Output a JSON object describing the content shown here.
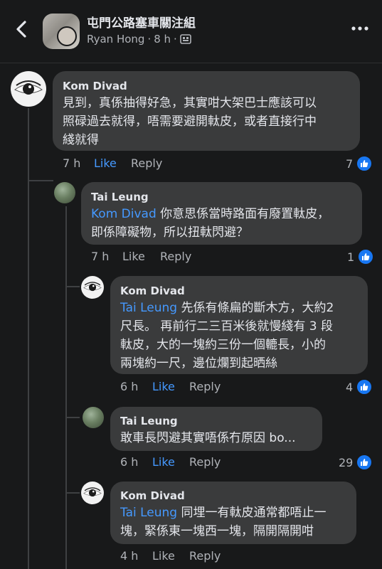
{
  "header": {
    "title": "屯門公路塞車關注組",
    "author": "Ryan Hong",
    "time": "8 h",
    "separator": "·"
  },
  "comments": [
    {
      "name": "Kom Divad",
      "mention": "",
      "text_lines": [
        "見到，真係抽得好急，其實咁大架巴士應該可以",
        "照碌過去就得，唔需要避開軚皮，或者直接行中",
        "綫就得"
      ],
      "time": "7 h",
      "like": "Like",
      "reply": "Reply",
      "reactions": "7",
      "like_active": true
    },
    {
      "name": "Tai Leung",
      "mention": "Kom Divad",
      "text_lines": [
        " 你意思係當時路面有廢置軚皮，",
        "即係障礙物，所以扭軚閃避？"
      ],
      "time": "7 h",
      "like": "Like",
      "reply": "Reply",
      "reactions": "1",
      "like_active": false
    },
    {
      "name": "Kom Divad",
      "mention": "Tai Leung",
      "text_lines": [
        " 先係有條扁的斷木方，大約2",
        "尺長。 再前行二三百米後就慢綫有 3 段",
        "軚皮，大的一塊約三份一個轆長，小的",
        "兩塊約一尺，邊位爛到起晒絲"
      ],
      "time": "6 h",
      "like": "Like",
      "reply": "Reply",
      "reactions": "4",
      "like_active": true
    },
    {
      "name": "Tai Leung",
      "mention": "",
      "text_lines": [
        "敢車長閃避其實唔係冇原因 bo..."
      ],
      "time": "6 h",
      "like": "Like",
      "reply": "Reply",
      "reactions": "29",
      "like_active": true
    },
    {
      "name": "Kom Divad",
      "mention": "Tai Leung",
      "text_lines": [
        " 同埋一有軚皮通常都唔止一",
        "塊，緊係東一塊西一塊，隔開隔開咁"
      ],
      "time": "4 h",
      "like": "Like",
      "reply": "Reply",
      "reactions": "",
      "like_active": false
    }
  ]
}
